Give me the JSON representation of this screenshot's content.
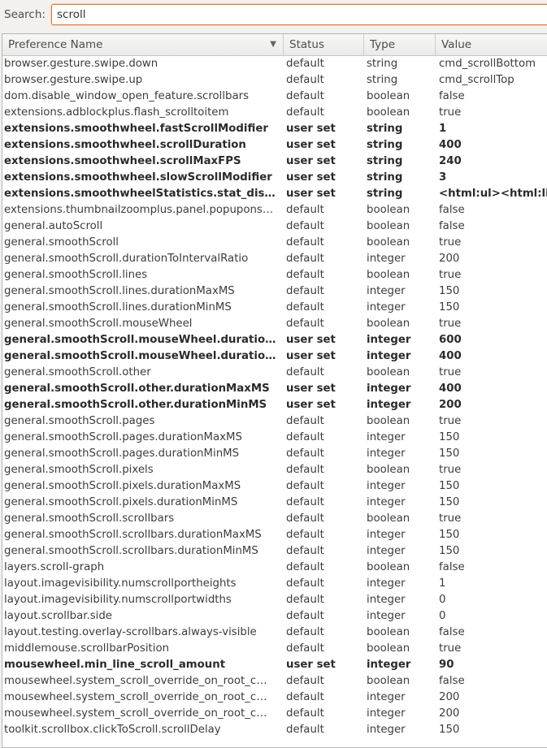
{
  "search": {
    "label": "Search:",
    "value": "scroll"
  },
  "columns": {
    "name": "Preference Name",
    "status": "Status",
    "type": "Type",
    "value": "Value"
  },
  "rows": [
    {
      "name": "browser.gesture.swipe.down",
      "status": "default",
      "type": "string",
      "value": "cmd_scrollBottom",
      "user_set": false
    },
    {
      "name": "browser.gesture.swipe.up",
      "status": "default",
      "type": "string",
      "value": "cmd_scrollTop",
      "user_set": false
    },
    {
      "name": "dom.disable_window_open_feature.scrollbars",
      "status": "default",
      "type": "boolean",
      "value": "false",
      "user_set": false
    },
    {
      "name": "extensions.adblockplus.flash_scrolltoitem",
      "status": "default",
      "type": "boolean",
      "value": "true",
      "user_set": false
    },
    {
      "name": "extensions.smoothwheel.fastScrollModifier",
      "status": "user set",
      "type": "string",
      "value": "1",
      "user_set": true
    },
    {
      "name": "extensions.smoothwheel.scrollDuration",
      "status": "user set",
      "type": "string",
      "value": "400",
      "user_set": true
    },
    {
      "name": "extensions.smoothwheel.scrollMaxFPS",
      "status": "user set",
      "type": "string",
      "value": "240",
      "user_set": true
    },
    {
      "name": "extensions.smoothwheel.slowScrollModifier",
      "status": "user set",
      "type": "string",
      "value": "3",
      "user_set": true
    },
    {
      "name": "extensions.smoothwheelStatistics.stat_display",
      "status": "user set",
      "type": "string",
      "value": "<html:ul><html:li>S",
      "user_set": true
    },
    {
      "name": "extensions.thumbnailzoomplus.panel.popupons…",
      "status": "default",
      "type": "boolean",
      "value": "false",
      "user_set": false
    },
    {
      "name": "general.autoScroll",
      "status": "default",
      "type": "boolean",
      "value": "false",
      "user_set": false
    },
    {
      "name": "general.smoothScroll",
      "status": "default",
      "type": "boolean",
      "value": "true",
      "user_set": false
    },
    {
      "name": "general.smoothScroll.durationToIntervalRatio",
      "status": "default",
      "type": "integer",
      "value": "200",
      "user_set": false
    },
    {
      "name": "general.smoothScroll.lines",
      "status": "default",
      "type": "boolean",
      "value": "true",
      "user_set": false
    },
    {
      "name": "general.smoothScroll.lines.durationMaxMS",
      "status": "default",
      "type": "integer",
      "value": "150",
      "user_set": false
    },
    {
      "name": "general.smoothScroll.lines.durationMinMS",
      "status": "default",
      "type": "integer",
      "value": "150",
      "user_set": false
    },
    {
      "name": "general.smoothScroll.mouseWheel",
      "status": "default",
      "type": "boolean",
      "value": "true",
      "user_set": false
    },
    {
      "name": "general.smoothScroll.mouseWheel.duration…",
      "status": "user set",
      "type": "integer",
      "value": "600",
      "user_set": true
    },
    {
      "name": "general.smoothScroll.mouseWheel.duration…",
      "status": "user set",
      "type": "integer",
      "value": "400",
      "user_set": true
    },
    {
      "name": "general.smoothScroll.other",
      "status": "default",
      "type": "boolean",
      "value": "true",
      "user_set": false
    },
    {
      "name": "general.smoothScroll.other.durationMaxMS",
      "status": "user set",
      "type": "integer",
      "value": "400",
      "user_set": true
    },
    {
      "name": "general.smoothScroll.other.durationMinMS",
      "status": "user set",
      "type": "integer",
      "value": "200",
      "user_set": true
    },
    {
      "name": "general.smoothScroll.pages",
      "status": "default",
      "type": "boolean",
      "value": "true",
      "user_set": false
    },
    {
      "name": "general.smoothScroll.pages.durationMaxMS",
      "status": "default",
      "type": "integer",
      "value": "150",
      "user_set": false
    },
    {
      "name": "general.smoothScroll.pages.durationMinMS",
      "status": "default",
      "type": "integer",
      "value": "150",
      "user_set": false
    },
    {
      "name": "general.smoothScroll.pixels",
      "status": "default",
      "type": "boolean",
      "value": "true",
      "user_set": false
    },
    {
      "name": "general.smoothScroll.pixels.durationMaxMS",
      "status": "default",
      "type": "integer",
      "value": "150",
      "user_set": false
    },
    {
      "name": "general.smoothScroll.pixels.durationMinMS",
      "status": "default",
      "type": "integer",
      "value": "150",
      "user_set": false
    },
    {
      "name": "general.smoothScroll.scrollbars",
      "status": "default",
      "type": "boolean",
      "value": "true",
      "user_set": false
    },
    {
      "name": "general.smoothScroll.scrollbars.durationMaxMS",
      "status": "default",
      "type": "integer",
      "value": "150",
      "user_set": false
    },
    {
      "name": "general.smoothScroll.scrollbars.durationMinMS",
      "status": "default",
      "type": "integer",
      "value": "150",
      "user_set": false
    },
    {
      "name": "layers.scroll-graph",
      "status": "default",
      "type": "boolean",
      "value": "false",
      "user_set": false
    },
    {
      "name": "layout.imagevisibility.numscrollportheights",
      "status": "default",
      "type": "integer",
      "value": "1",
      "user_set": false
    },
    {
      "name": "layout.imagevisibility.numscrollportwidths",
      "status": "default",
      "type": "integer",
      "value": "0",
      "user_set": false
    },
    {
      "name": "layout.scrollbar.side",
      "status": "default",
      "type": "integer",
      "value": "0",
      "user_set": false
    },
    {
      "name": "layout.testing.overlay-scrollbars.always-visible",
      "status": "default",
      "type": "boolean",
      "value": "false",
      "user_set": false
    },
    {
      "name": "middlemouse.scrollbarPosition",
      "status": "default",
      "type": "boolean",
      "value": "true",
      "user_set": false
    },
    {
      "name": "mousewheel.min_line_scroll_amount",
      "status": "user set",
      "type": "integer",
      "value": "90",
      "user_set": true
    },
    {
      "name": "mousewheel.system_scroll_override_on_root_c…",
      "status": "default",
      "type": "boolean",
      "value": "false",
      "user_set": false
    },
    {
      "name": "mousewheel.system_scroll_override_on_root_c…",
      "status": "default",
      "type": "integer",
      "value": "200",
      "user_set": false
    },
    {
      "name": "mousewheel.system_scroll_override_on_root_c…",
      "status": "default",
      "type": "integer",
      "value": "200",
      "user_set": false
    },
    {
      "name": "toolkit.scrollbox.clickToScroll.scrollDelay",
      "status": "default",
      "type": "integer",
      "value": "150",
      "user_set": false
    }
  ]
}
